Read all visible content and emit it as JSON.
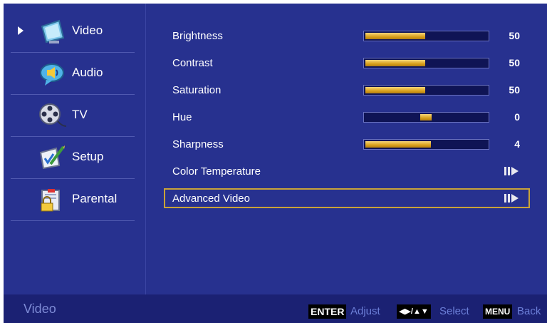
{
  "sidebar": {
    "items": [
      {
        "label": "Video",
        "icon": "video-icon",
        "selected": true
      },
      {
        "label": "Audio",
        "icon": "audio-icon",
        "selected": false
      },
      {
        "label": "TV",
        "icon": "tv-reel-icon",
        "selected": false
      },
      {
        "label": "Setup",
        "icon": "setup-icon",
        "selected": false
      },
      {
        "label": "Parental",
        "icon": "parental-lock-icon",
        "selected": false
      }
    ]
  },
  "settings": [
    {
      "label": "Brightness",
      "type": "slider",
      "value": "50",
      "level": 0.5
    },
    {
      "label": "Contrast",
      "type": "slider",
      "value": "50",
      "level": 0.5
    },
    {
      "label": "Saturation",
      "type": "slider",
      "value": "50",
      "level": 0.5
    },
    {
      "label": "Hue",
      "type": "slider",
      "value": "0",
      "level": 0.5
    },
    {
      "label": "Sharpness",
      "type": "slider",
      "value": "4",
      "level": 0.55
    },
    {
      "label": "Color Temperature",
      "type": "submenu"
    },
    {
      "label": "Advanced Video",
      "type": "submenu",
      "selected": true
    }
  ],
  "status_bar": {
    "title": "Video",
    "enter_key": "ENTER",
    "enter_action": "Adjust",
    "select_key": "◀▶/▲▼",
    "select_action": "Select",
    "menu_key": "MENU",
    "menu_action": "Back"
  },
  "colors": {
    "background": "#27318f",
    "slider_fill": "#d9a11d",
    "selection_border": "#c9a339",
    "hint_text": "#6c7fd8"
  }
}
